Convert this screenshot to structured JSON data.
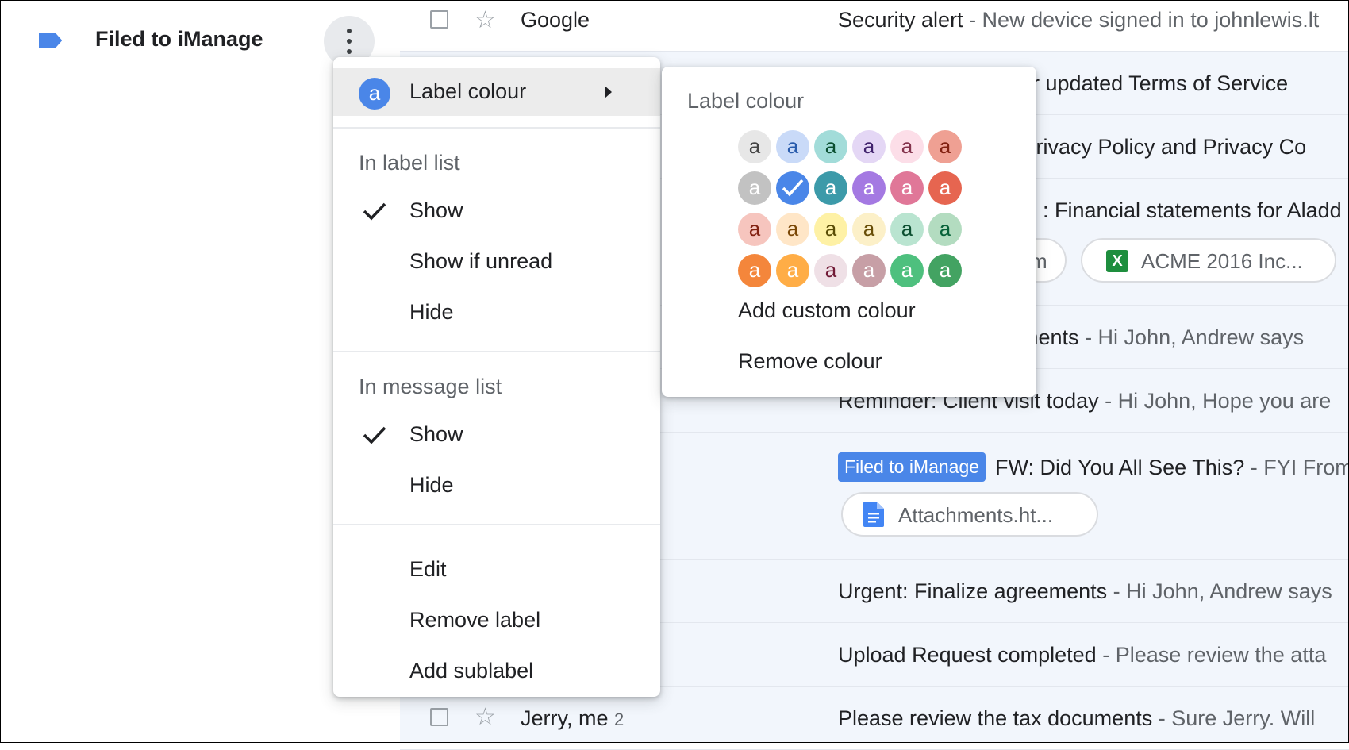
{
  "sidebar": {
    "label_name": "Filed to iManage"
  },
  "colors": {
    "label_blue": "#4a86e8",
    "list_bg": "#f2f6fc",
    "menu_highlight": "#ececec"
  },
  "messages": {
    "row0": {
      "sender": "Google",
      "subject": "Security alert",
      "snippet": " - New device signed in to johnlewis.lt"
    },
    "row1": {
      "subject_visible": "t our updated Terms of Service"
    },
    "row2": {
      "subject_visible": "ur Privacy Policy and Privacy Co"
    },
    "row3": {
      "subject_visible": ": Financial statements for Aladd",
      "chip_partial": "m",
      "chip_excel": "ACME 2016 Inc..."
    },
    "row4": {
      "subject_visible": "eements",
      "snippet": " - Hi John, Andrew says"
    },
    "row5": {
      "subject": "Reminder: Client visit today",
      "snippet": " - Hi John, Hope you are"
    },
    "row6": {
      "badge": "Filed to iManage",
      "subject": "FW: Did You All See This?",
      "snippet": " - FYI From",
      "attachment": "Attachments.ht..."
    },
    "row7": {
      "subject": "Urgent: Finalize agreements",
      "snippet": " - Hi John, Andrew says"
    },
    "row8": {
      "subject": "Upload Request completed",
      "snippet": " - Please review the atta"
    },
    "row9": {
      "sender": "Jerry, me",
      "count": "2",
      "subject": "Please review the tax documents",
      "snippet": " - Sure Jerry. Will"
    }
  },
  "menu": {
    "label_colour": "Label colour",
    "label_colour_avatar": "a",
    "in_label_list": "In label list",
    "label_list_show": "Show",
    "label_list_show_if_unread": "Show if unread",
    "label_list_hide": "Hide",
    "in_message_list": "In message list",
    "message_list_show": "Show",
    "message_list_hide": "Hide",
    "edit": "Edit",
    "remove_label": "Remove label",
    "add_sublabel": "Add sublabel"
  },
  "submenu": {
    "title": "Label colour",
    "swatch_letter": "a",
    "selected": "row 2, column 2",
    "swatches": [
      [
        {
          "bg": "#e7e7e7",
          "fg": "#464646"
        },
        {
          "bg": "#c9daf8",
          "fg": "#285bac"
        },
        {
          "bg": "#a2dcd9",
          "fg": "#0b4f30"
        },
        {
          "bg": "#e4d7f5",
          "fg": "#41236d"
        },
        {
          "bg": "#fcdee8",
          "fg": "#83334c"
        },
        {
          "bg": "#efa093",
          "fg": "#822111"
        }
      ],
      [
        {
          "bg": "#c2c2c2",
          "fg": "#ffffff"
        },
        {
          "bg": "#4a86e8",
          "fg": "#ffffff"
        },
        {
          "bg": "#3c9aa9",
          "fg": "#ffffff"
        },
        {
          "bg": "#a479e2",
          "fg": "#ffffff"
        },
        {
          "bg": "#e07798",
          "fg": "#ffffff"
        },
        {
          "bg": "#e66550",
          "fg": "#ffffff"
        }
      ],
      [
        {
          "bg": "#f6c5be",
          "fg": "#822111"
        },
        {
          "bg": "#ffe6c7",
          "fg": "#7a4706"
        },
        {
          "bg": "#fef1a5",
          "fg": "#594c05"
        },
        {
          "bg": "#fcf0c8",
          "fg": "#684e07"
        },
        {
          "bg": "#b9e4d0",
          "fg": "#0b4f30"
        },
        {
          "bg": "#b3dcc0",
          "fg": "#076239"
        }
      ],
      [
        {
          "bg": "#f4863b",
          "fg": "#ffffff"
        },
        {
          "bg": "#ffad46",
          "fg": "#ffffff"
        },
        {
          "bg": "#efe0e6",
          "fg": "#711a36"
        },
        {
          "bg": "#c79fa6",
          "fg": "#ffffff"
        },
        {
          "bg": "#4ec07e",
          "fg": "#ffffff"
        },
        {
          "bg": "#43a362",
          "fg": "#ffffff"
        }
      ]
    ],
    "add_custom_colour": "Add custom colour",
    "remove_colour": "Remove colour"
  }
}
